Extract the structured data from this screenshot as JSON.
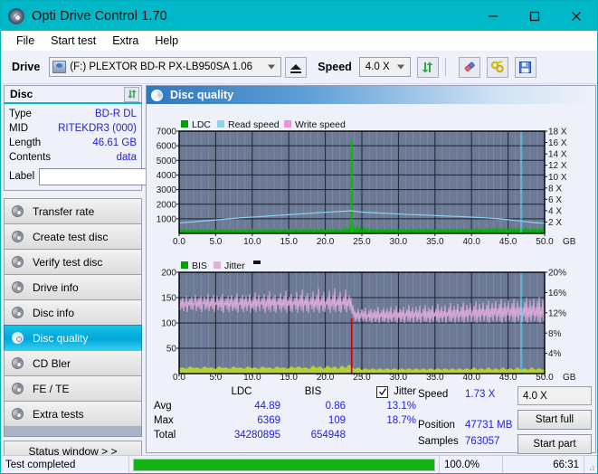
{
  "window": {
    "title": "Opti Drive Control 1.70",
    "icon": "disc-icon",
    "minimize": "minimize-icon",
    "maximize": "maximize-icon",
    "close": "close-icon"
  },
  "menu": {
    "items": [
      "File",
      "Start test",
      "Extra",
      "Help"
    ]
  },
  "toolbar": {
    "drive_label": "Drive",
    "drive_value": "(F:)  PLEXTOR BD-R  PX-LB950SA 1.06",
    "eject_icon": "eject-icon",
    "speed_label": "Speed",
    "speed_value": "4.0 X",
    "refresh_icon": "refresh-icon",
    "erase_icon": "eraser-icon",
    "settings_icon": "tools-icon",
    "save_icon": "save-icon"
  },
  "disc_panel": {
    "header": "Disc",
    "refresh_icon": "refresh-icon",
    "rows": [
      {
        "key": "Type",
        "value": "BD-R DL"
      },
      {
        "key": "MID",
        "value": "RITEKDR3 (000)"
      },
      {
        "key": "Length",
        "value": "46.61 GB"
      },
      {
        "key": "Contents",
        "value": "data"
      }
    ],
    "label_key": "Label",
    "label_value": "",
    "label_placeholder": "",
    "disc_button_icon": "cd-icon"
  },
  "sidebar": {
    "items": [
      {
        "label": "Transfer rate",
        "icon": "disc-icon",
        "active": false
      },
      {
        "label": "Create test disc",
        "icon": "disc-icon",
        "active": false
      },
      {
        "label": "Verify test disc",
        "icon": "disc-icon",
        "active": false
      },
      {
        "label": "Drive info",
        "icon": "disc-icon",
        "active": false
      },
      {
        "label": "Disc info",
        "icon": "disc-icon",
        "active": false
      },
      {
        "label": "Disc quality",
        "icon": "disc-icon",
        "active": true
      },
      {
        "label": "CD Bler",
        "icon": "disc-icon",
        "active": false
      },
      {
        "label": "FE / TE",
        "icon": "disc-icon",
        "active": false
      },
      {
        "label": "Extra tests",
        "icon": "disc-icon",
        "active": false
      }
    ],
    "status_window": "Status window > >"
  },
  "main": {
    "header": "Disc quality",
    "header_icon": "disc-icon"
  },
  "chart_data": [
    {
      "type": "area",
      "name": "top-chart",
      "title": "",
      "xlabel": "GB",
      "ylabel": "",
      "xlim": [
        0,
        50
      ],
      "ylim": [
        0,
        7000
      ],
      "y2lim": [
        0,
        18
      ],
      "y2label": "X",
      "xticks": [
        "0.0",
        "5.0",
        "10.0",
        "15.0",
        "20.0",
        "25.0",
        "30.0",
        "35.0",
        "40.0",
        "45.0",
        "50.0"
      ],
      "yticks": [
        "1000",
        "2000",
        "3000",
        "4000",
        "5000",
        "6000",
        "7000"
      ],
      "y2ticks": [
        "2 X",
        "4 X",
        "6 X",
        "8 X",
        "10 X",
        "12 X",
        "14 X",
        "16 X",
        "18 X"
      ],
      "x_unit": "GB",
      "grid": true,
      "legend_position": "top-left",
      "legend": [
        {
          "label": "LDC",
          "color": "#00a000"
        },
        {
          "label": "Read speed",
          "color": "#8fd2f0"
        },
        {
          "label": "Write speed",
          "color": "#f58ee0"
        }
      ],
      "series": [
        {
          "name": "LDC",
          "color": "#00a000",
          "note": "dense green noise floor ~30-150, large spike to 6369 at 23.5 GB"
        },
        {
          "name": "Read speed",
          "color": "#8fd2f0",
          "note": "stepped curve rising from ~2.0X at 0 GB to ~4.3X at 23 GB then falling to ~3.0X at 46.8 GB"
        }
      ],
      "cursor_lines": [
        {
          "x": 46.8,
          "color": "#4fd8f5"
        }
      ]
    },
    {
      "type": "area",
      "name": "bottom-chart",
      "title": "",
      "xlabel": "GB",
      "ylabel": "",
      "xlim": [
        0,
        50
      ],
      "ylim": [
        0,
        200
      ],
      "y2lim": [
        0,
        20
      ],
      "y2label": "%",
      "xticks": [
        "0.0",
        "5.0",
        "10.0",
        "15.0",
        "20.0",
        "25.0",
        "30.0",
        "35.0",
        "40.0",
        "45.0",
        "50.0"
      ],
      "yticks": [
        "50",
        "100",
        "150",
        "200"
      ],
      "y2ticks": [
        "4%",
        "8%",
        "12%",
        "16%",
        "20%"
      ],
      "x_unit": "GB",
      "grid": true,
      "legend_position": "top-left",
      "legend": [
        {
          "label": "BIS",
          "color": "#00a000"
        },
        {
          "label": "Jitter",
          "color": "#e2aede"
        }
      ],
      "series": [
        {
          "name": "BIS",
          "color": "#bcd12a",
          "note": "low yellow-green noise band 0-12, red max spike 109 at 23.5 GB"
        },
        {
          "name": "Jitter",
          "color": "#e2aede",
          "note": "noisy band averaging 13.1%, ~14% early, dips to ~12.5% after 23.5 GB"
        }
      ],
      "cursor_lines": [
        {
          "x": 23.5,
          "color": "#cc0000"
        },
        {
          "x": 46.8,
          "color": "#4fd8f5"
        }
      ]
    }
  ],
  "stats": {
    "columns": [
      "LDC",
      "BIS"
    ],
    "jitter_label": "Jitter",
    "jitter_checked": true,
    "rows": [
      {
        "key": "Avg",
        "ldc": "44.89",
        "bis": "0.86",
        "jitter": "13.1%"
      },
      {
        "key": "Max",
        "ldc": "6369",
        "bis": "109",
        "jitter": "18.7%"
      },
      {
        "key": "Total",
        "ldc": "34280895",
        "bis": "654948",
        "jitter": ""
      }
    ]
  },
  "readout": {
    "rows": [
      {
        "key": "Speed",
        "value": "1.73 X"
      },
      {
        "key": "Position",
        "value": "47731 MB"
      },
      {
        "key": "Samples",
        "value": "763057"
      }
    ],
    "speed_select": "4.0 X",
    "start_full": "Start full",
    "start_part": "Start part"
  },
  "statusbar": {
    "message": "Test completed",
    "progress_percent": "100.0%",
    "progress_value": 100,
    "elapsed": "66:31"
  }
}
